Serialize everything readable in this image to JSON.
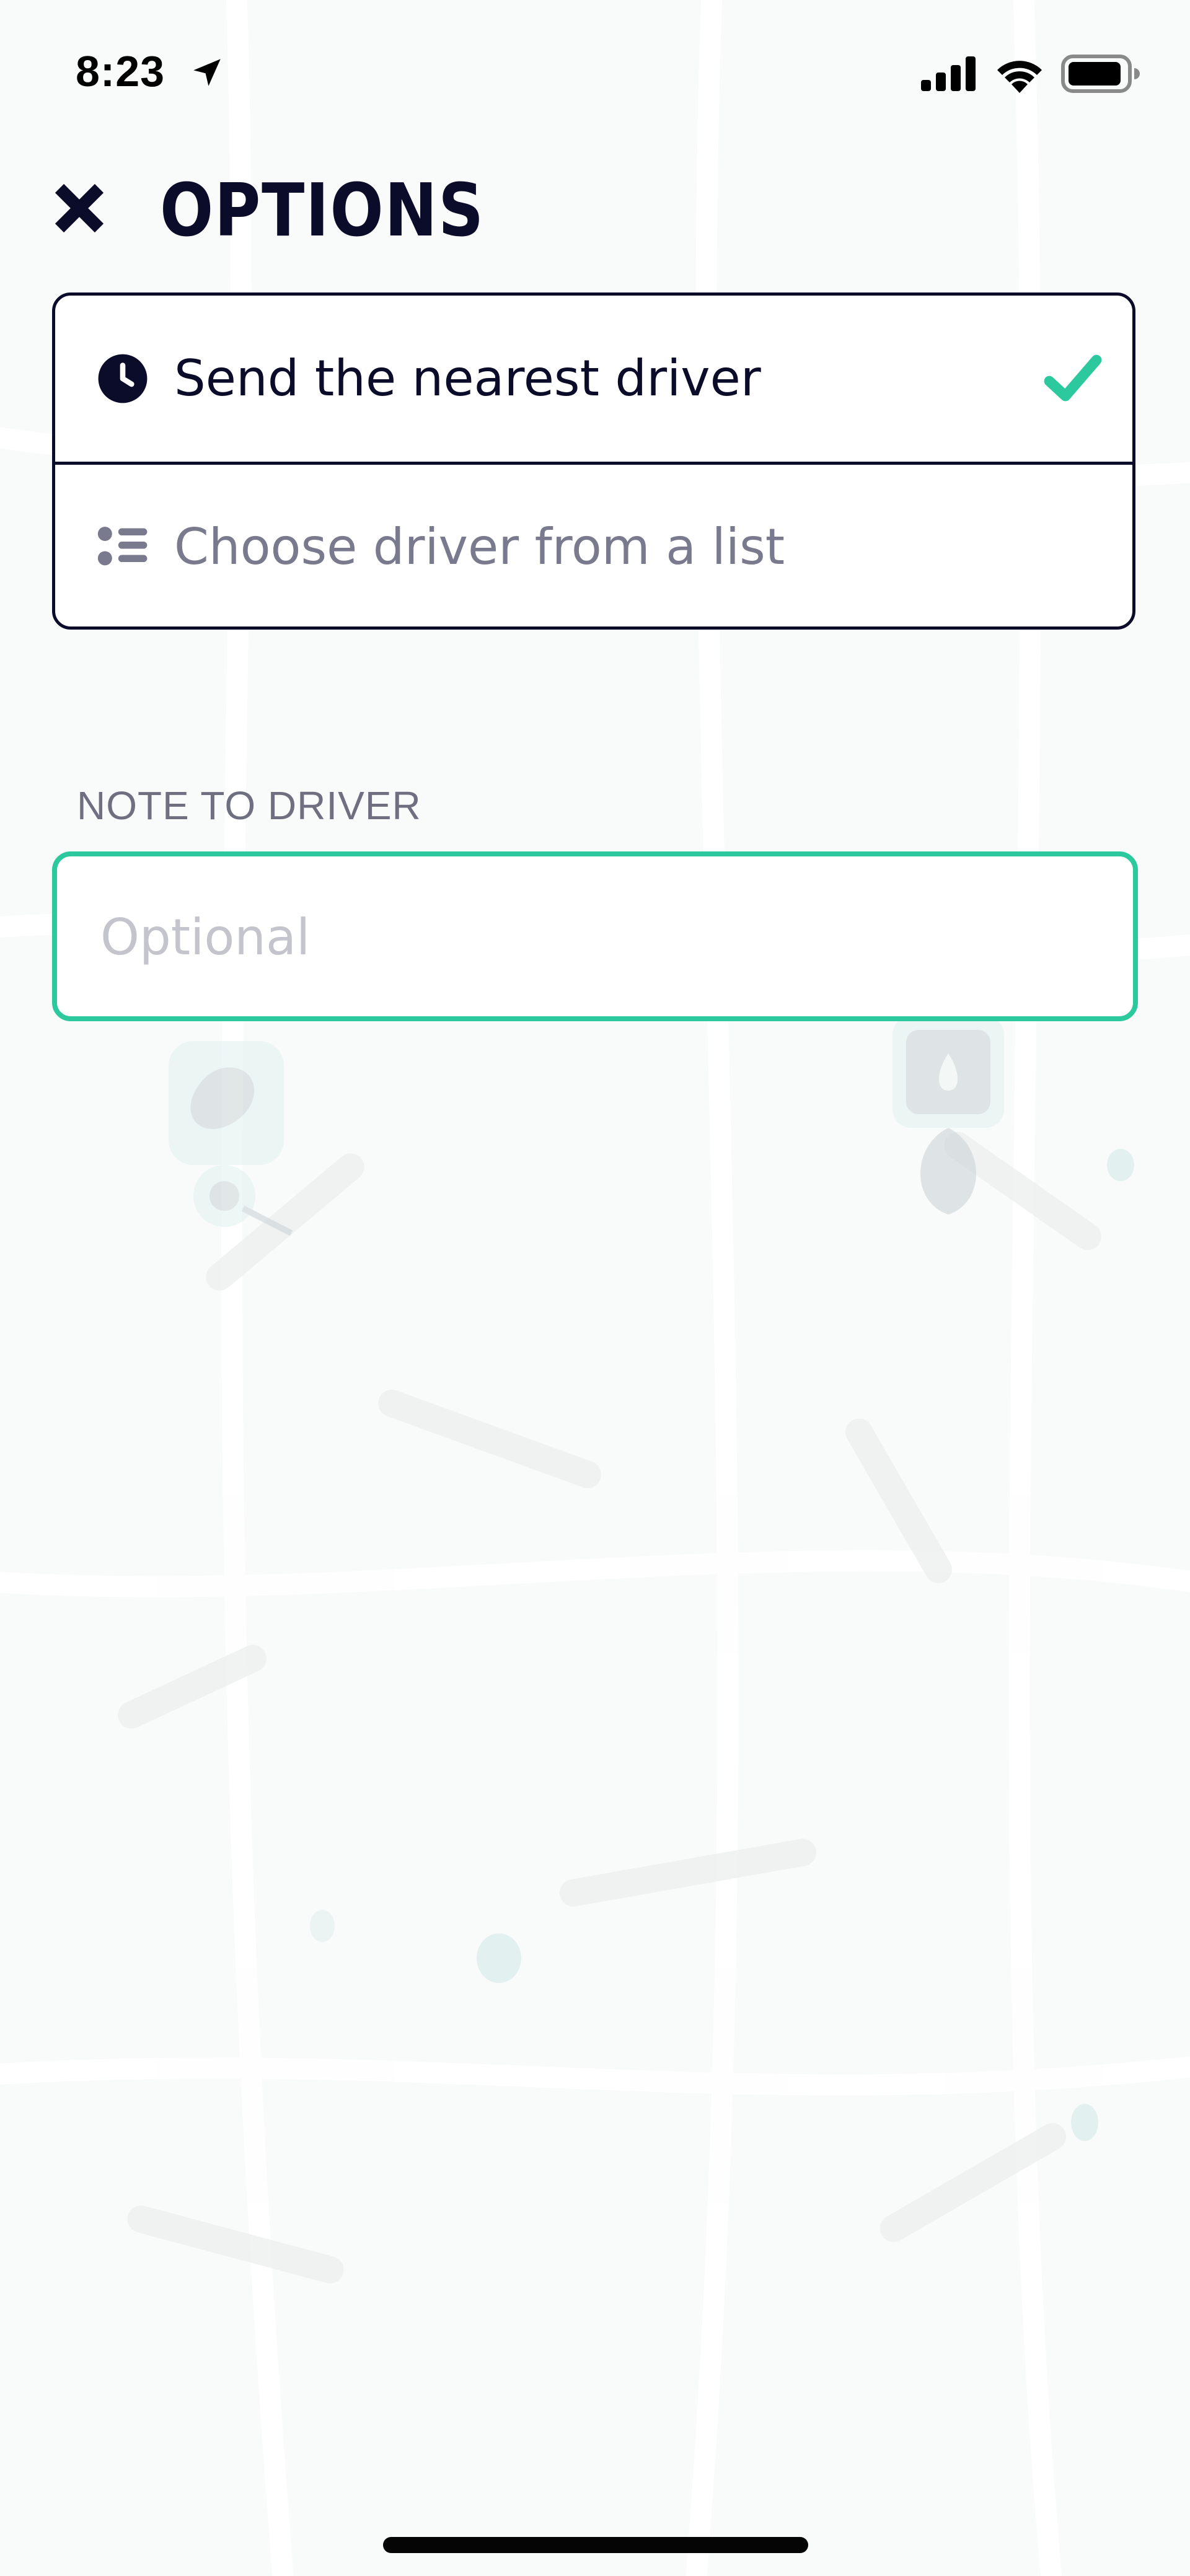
{
  "status_bar": {
    "time": "8:23",
    "location_icon": "location-arrow-icon",
    "signal_icon": "cellular-signal-icon",
    "wifi_icon": "wifi-icon",
    "battery_icon": "battery-icon"
  },
  "header": {
    "title": "OPTIONS",
    "close_icon": "close-icon"
  },
  "options": [
    {
      "label": "Send the nearest driver",
      "icon": "clock-icon",
      "selected": true
    },
    {
      "label": "Choose driver from a list",
      "icon": "list-icon",
      "selected": false
    }
  ],
  "note": {
    "label": "NOTE TO DRIVER",
    "placeholder": "Optional",
    "value": ""
  },
  "colors": {
    "accent": "#2dc99e",
    "text_dark": "#0b0b2a",
    "text_muted": "#7a7a8e",
    "placeholder": "#c4c4cc",
    "background": "#f9fafa"
  }
}
